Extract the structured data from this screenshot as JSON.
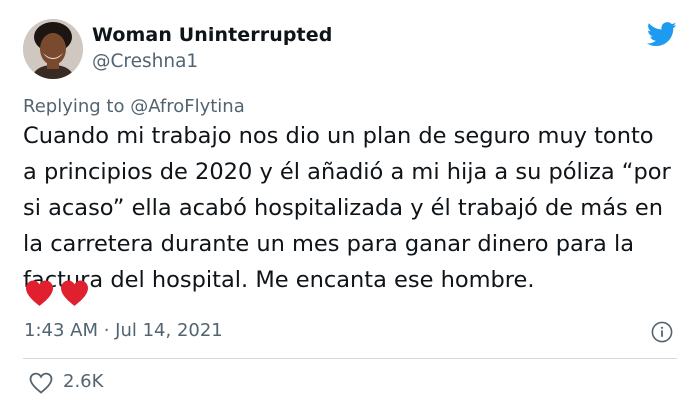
{
  "author": {
    "name": "Woman Uninterrupted",
    "handle": "@Creshna1"
  },
  "reply": {
    "prefix": "Replying to",
    "mention": "@AfroFlytina"
  },
  "tweet": {
    "lines": [
      "Cuando mi trabajo nos dio un plan de seguro muy tonto",
      "a principios de 2020 y él añadió a mi hija a su póliza “por",
      "si acaso” ella acabó hospitalizada y él trabajó de más en",
      "la carretera durante un mes para ganar dinero para la",
      "factura del hospital. Me encanta ese hombre."
    ],
    "emoji": [
      "red-heart",
      "red-heart"
    ]
  },
  "meta": {
    "timestamp": "1:43 AM · Jul 14, 2021"
  },
  "engagement": {
    "likes": "2.6K"
  },
  "icons": {
    "logo": "twitter-bird-icon",
    "info": "info-icon",
    "like": "heart-outline-icon"
  },
  "colors": {
    "brand": "#1d9bf0",
    "text": "#0f1419",
    "secondary": "#536471",
    "heart": "#e0202e"
  }
}
